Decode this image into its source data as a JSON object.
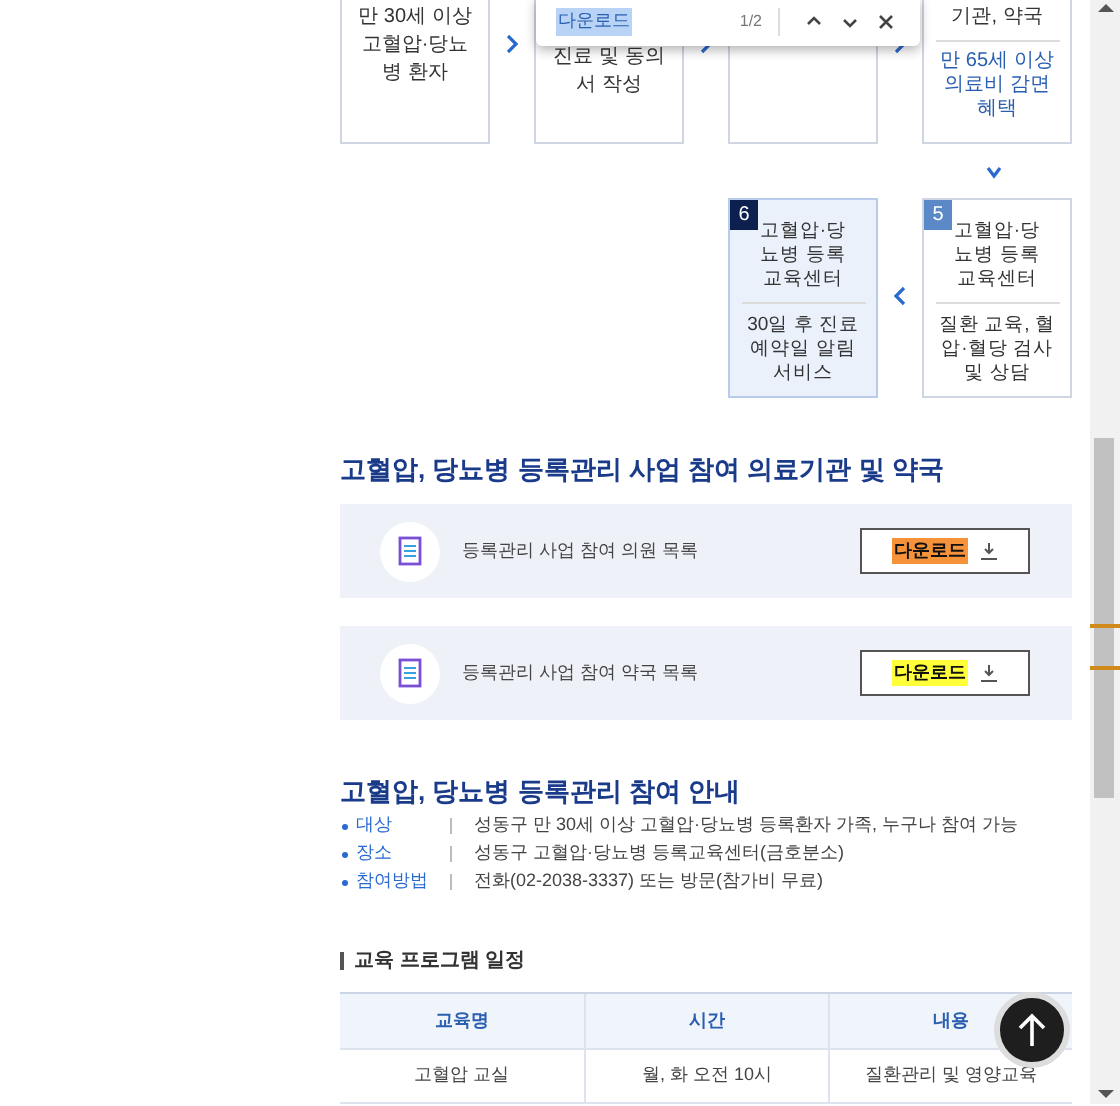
{
  "find_bar": {
    "query": "다운로드",
    "count": "1/2"
  },
  "steps_top": [
    {
      "kind": "text",
      "title": "만 30세 이상 고혈압·당뇨병 환자"
    },
    {
      "kind": "text",
      "title": "진료 및 동의서 작성"
    },
    {
      "kind": "covered"
    },
    {
      "kind": "text",
      "title": "기관, 약국",
      "detail": "만 65세 이상 의료비 감면 혜택"
    }
  ],
  "steps_bottom": [
    {
      "number": "6",
      "title": "고혈압·당뇨병 등록 교육센터",
      "detail": "30일 후 진료 예약일 알림 서비스",
      "selected": true
    },
    {
      "number": "5",
      "title": "고혈압·당뇨병 등록 교육센터",
      "detail": "질환 교육, 혈압·혈당 검사 및 상담",
      "selected": false
    }
  ],
  "section_title": "고혈압, 당뇨병 등록관리 사업 참여 의료기관 및 약국",
  "downloads": [
    {
      "label": "등록관리 사업 참여 의원 목록",
      "button": "다운로드",
      "current_match": true
    },
    {
      "label": "등록관리 사업 참여 약국 목록",
      "button": "다운로드",
      "current_match": false
    }
  ],
  "info_title": "고혈압, 당뇨병 등록관리 참여 안내",
  "info": [
    {
      "term": "대상",
      "text": "성동구 만 30세 이상 고혈압·당뇨병 등록환자 가족, 누구나 참여 가능"
    },
    {
      "term": "장소",
      "text": "성동구 고혈압·당뇨병 등록교육센터(금호분소)"
    },
    {
      "term": "참여방법",
      "text": "전화(02-2038-3337) 또는 방문(참가비 무료)"
    }
  ],
  "schedule_title": "교육 프로그램 일정",
  "table": {
    "columns": [
      "교육명",
      "시간",
      "내용"
    ],
    "rows": [
      [
        "고혈압 교실",
        "월, 화 오전 10시",
        "질환관리 및 영양교육"
      ]
    ]
  }
}
